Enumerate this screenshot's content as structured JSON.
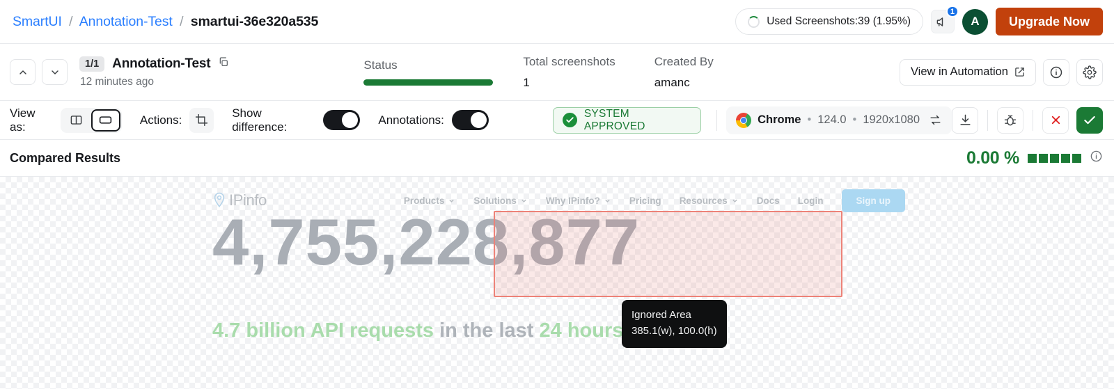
{
  "topbar": {
    "breadcrumb": {
      "root": "SmartUI",
      "project": "Annotation-Test",
      "current": "smartui-36e320a535",
      "separator": "/"
    },
    "usage_label": "Used Screenshots:39 (1.95%)",
    "notification_count": "1",
    "avatar_initial": "A",
    "upgrade_label": "Upgrade Now"
  },
  "meta": {
    "counter": "1/1",
    "title": "Annotation-Test",
    "timestamp": "12 minutes ago",
    "columns": [
      {
        "label": "Status",
        "value": ""
      },
      {
        "label": "Total screenshots",
        "value": "1"
      },
      {
        "label": "Created By",
        "value": "amanc"
      }
    ],
    "view_automation_label": "View in Automation"
  },
  "toolbar": {
    "view_as_label": "View as:",
    "actions_label": "Actions:",
    "show_difference_label": "Show difference:",
    "annotations_label": "Annotations:",
    "show_difference_on": true,
    "annotations_on": true,
    "approval_status": "SYSTEM APPROVED",
    "browser": {
      "name": "Chrome",
      "version": "124.0",
      "resolution": "1920x1080",
      "dot": "•"
    }
  },
  "compared": {
    "title": "Compared Results",
    "diff_percent": "0.00 %",
    "meter_blocks": 5
  },
  "screenshot": {
    "site_name": "IPinfo",
    "nav_links": [
      {
        "label": "Products",
        "caret": true
      },
      {
        "label": "Solutions",
        "caret": true
      },
      {
        "label": "Why IPinfo?",
        "caret": true
      },
      {
        "label": "Pricing",
        "caret": false
      },
      {
        "label": "Resources",
        "caret": true
      },
      {
        "label": "Docs",
        "caret": false
      },
      {
        "label": "Login",
        "caret": false
      }
    ],
    "signup_label": "Sign up",
    "hero_number": "4,755,228,877",
    "hero_sub_green1": "4.7 billion API requests",
    "hero_sub_gray": " in the last ",
    "hero_sub_green2": "24 hours",
    "tooltip": {
      "title": "Ignored Area",
      "dimensions": "385.1(w), 100.0(h)"
    }
  },
  "colors": {
    "accent_blue": "#2b7fff",
    "brand_orange": "#c2410c",
    "success_green": "#1b7a35",
    "ignore_red": "#ed8278",
    "avatar_green": "#0b4f33"
  }
}
